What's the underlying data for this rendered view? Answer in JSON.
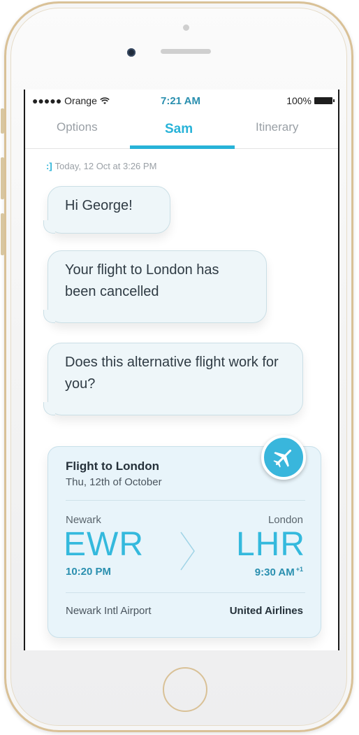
{
  "status_bar": {
    "carrier": "●●●●● Orange",
    "time": "7:21 AM",
    "battery": "100%"
  },
  "tabs": [
    {
      "label": "Options",
      "active": false
    },
    {
      "label": "Sam",
      "active": true
    },
    {
      "label": "Itinerary",
      "active": false
    }
  ],
  "chat": {
    "timestamp_icon": ":]",
    "timestamp": "Today, 12 Oct at 3:26 PM",
    "messages": [
      {
        "text": "Hi George!"
      },
      {
        "text": "Your flight to London has been cancelled"
      },
      {
        "text": "Does this alternative flight work for you?"
      }
    ]
  },
  "flight_card": {
    "title": "Flight to London",
    "date": "Thu, 12th of October",
    "from": {
      "city": "Newark",
      "code": "EWR",
      "time": "10:20 PM"
    },
    "to": {
      "city": "London",
      "code": "LHR",
      "time": "9:30 AM",
      "day_offset": "+1"
    },
    "airport": "Newark Intl Airport",
    "airline": "United Airlines",
    "badge_icon": "airplane-icon"
  },
  "colors": {
    "accent": "#28b3d8",
    "frame_gold": "#d9c197",
    "bubble_bg": "#eef6f9",
    "card_bg": "#e8f4fa"
  }
}
